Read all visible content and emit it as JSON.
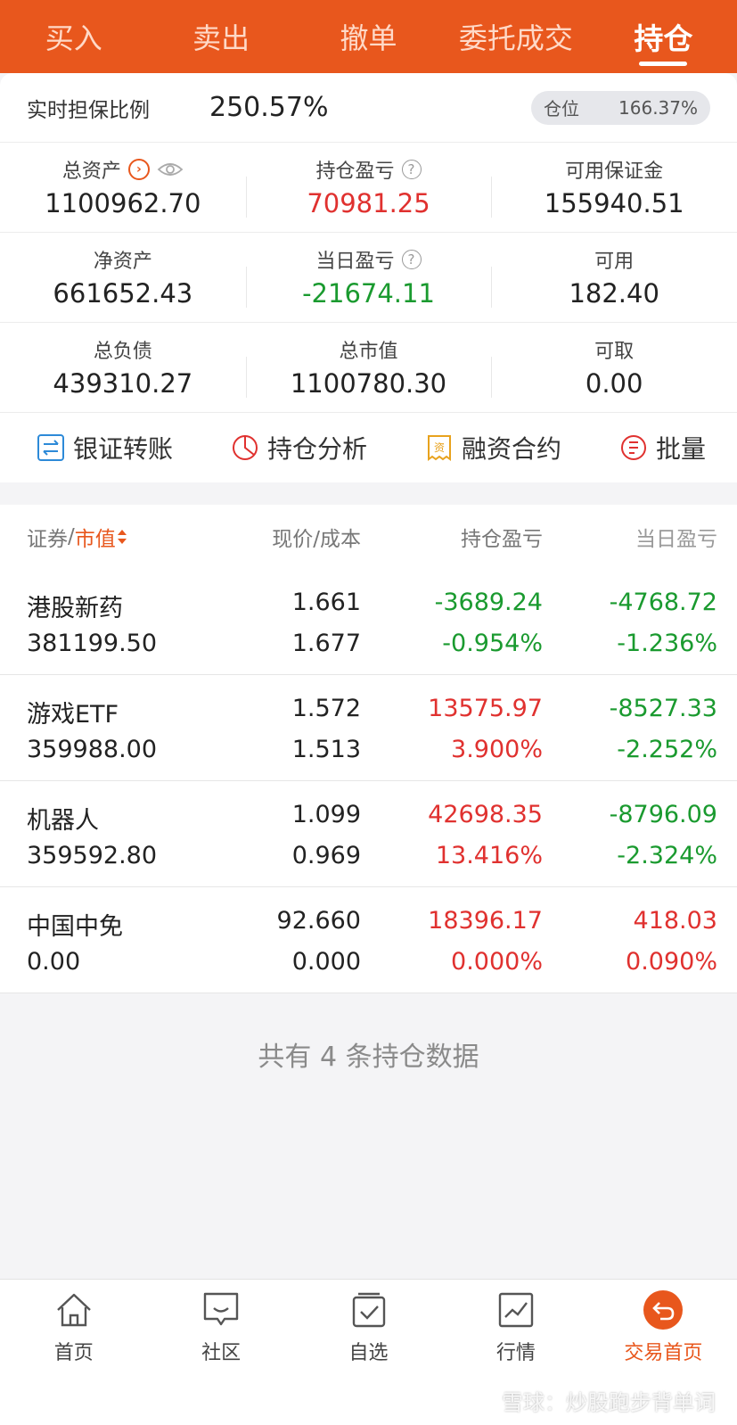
{
  "nav": {
    "tabs": [
      "买入",
      "卖出",
      "撤单",
      "委托成交",
      "持仓"
    ],
    "active_index": 4
  },
  "ratio": {
    "label": "实时担保比例",
    "value": "250.57%",
    "position_label": "仓位",
    "position_value": "166.37%"
  },
  "summary": [
    [
      {
        "label": "总资产",
        "value": "1100962.70"
      },
      {
        "label": "持仓盈亏",
        "value": "70981.25"
      },
      {
        "label": "可用保证金",
        "value": "155940.51"
      }
    ],
    [
      {
        "label": "净资产",
        "value": "661652.43"
      },
      {
        "label": "当日盈亏",
        "value": "-21674.11"
      },
      {
        "label": "可用",
        "value": "182.40"
      }
    ],
    [
      {
        "label": "总负债",
        "value": "439310.27"
      },
      {
        "label": "总市值",
        "value": "1100780.30"
      },
      {
        "label": "可取",
        "value": "0.00"
      }
    ]
  ],
  "actions": [
    {
      "label": "银证转账",
      "icon": "transfer-icon"
    },
    {
      "label": "持仓分析",
      "icon": "pie-chart-icon"
    },
    {
      "label": "融资合约",
      "icon": "contract-icon"
    },
    {
      "label": "批量",
      "icon": "batch-icon"
    }
  ],
  "list_header": {
    "security": "证券",
    "sep": "/",
    "market_value": "市值",
    "price": "现价/成本",
    "pnl": "持仓盈亏",
    "day_pnl": "当日盈亏"
  },
  "positions": [
    {
      "name": "港股新药",
      "market_value": "381199.50",
      "price": "1.661",
      "cost": "1.677",
      "pnl": "-3689.24",
      "pnl_pct": "-0.954%",
      "day_pnl": "-4768.72",
      "day_pnl_pct": "-1.236%"
    },
    {
      "name": "游戏ETF",
      "market_value": "359988.00",
      "price": "1.572",
      "cost": "1.513",
      "pnl": "13575.97",
      "pnl_pct": "3.900%",
      "day_pnl": "-8527.33",
      "day_pnl_pct": "-2.252%"
    },
    {
      "name": "机器人",
      "market_value": "359592.80",
      "price": "1.099",
      "cost": "0.969",
      "pnl": "42698.35",
      "pnl_pct": "13.416%",
      "day_pnl": "-8796.09",
      "day_pnl_pct": "-2.324%"
    },
    {
      "name": "中国中免",
      "market_value": "0.00",
      "price": "92.660",
      "cost": "0.000",
      "pnl": "18396.17",
      "pnl_pct": "0.000%",
      "day_pnl": "418.03",
      "day_pnl_pct": "0.090%"
    }
  ],
  "footer_note": "共有 4 条持仓数据",
  "bottom_nav": [
    {
      "label": "首页",
      "icon": "home-icon"
    },
    {
      "label": "社区",
      "icon": "chat-icon"
    },
    {
      "label": "自选",
      "icon": "checkbox-icon"
    },
    {
      "label": "行情",
      "icon": "chart-icon"
    },
    {
      "label": "交易首页",
      "icon": "trade-icon"
    }
  ],
  "watermark": "雪球：炒股跑步背单词",
  "colors": {
    "accent": "#e8571d",
    "up": "#e0312f",
    "down": "#1a9a2f"
  }
}
